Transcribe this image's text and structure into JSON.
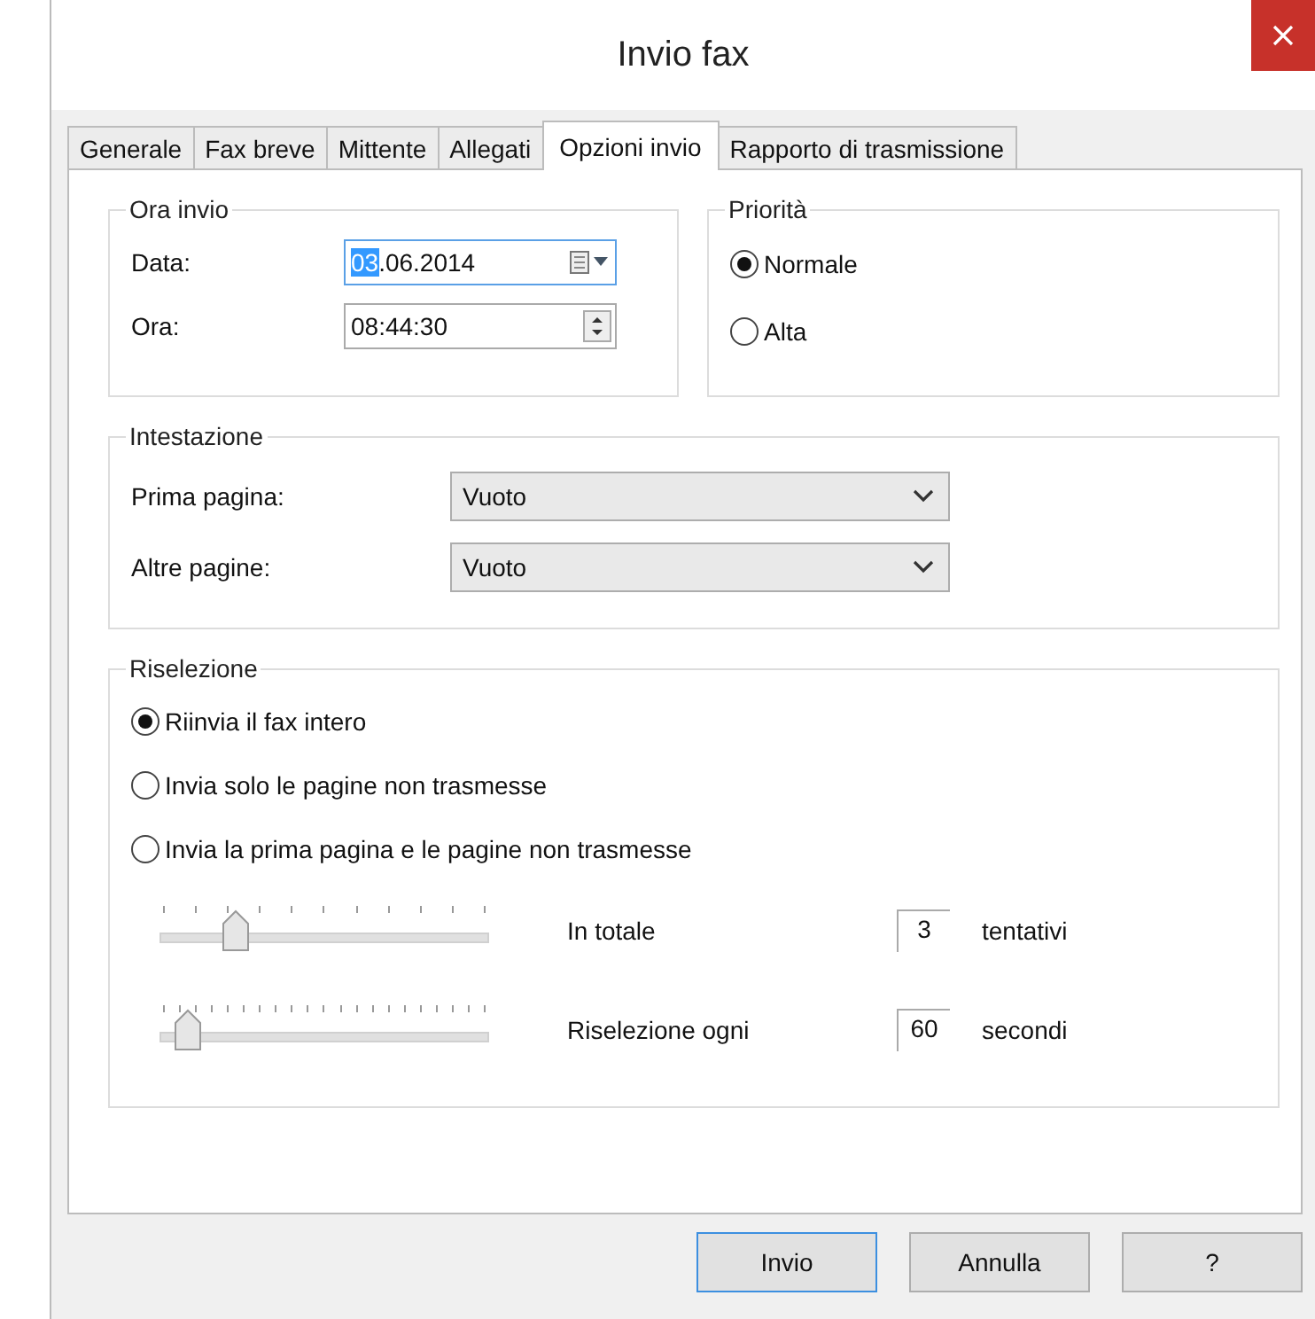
{
  "window": {
    "title": "Invio fax"
  },
  "tabs": [
    {
      "label": "Generale",
      "selected": false
    },
    {
      "label": "Fax breve",
      "selected": false
    },
    {
      "label": "Mittente",
      "selected": false
    },
    {
      "label": "Allegati",
      "selected": false
    },
    {
      "label": "Opzioni invio",
      "selected": true
    },
    {
      "label": "Rapporto di trasmissione",
      "selected": false
    }
  ],
  "ora_invio": {
    "title": "Ora invio",
    "date_label": "Data:",
    "date_selected": "03",
    "date_rest": ".06.2014",
    "time_label": "Ora:",
    "time_value": "08:44:30"
  },
  "priorita": {
    "title": "Priorità",
    "options": [
      {
        "label": "Normale",
        "selected": true
      },
      {
        "label": "Alta",
        "selected": false
      }
    ]
  },
  "intestazione": {
    "title": "Intestazione",
    "rows": [
      {
        "label": "Prima pagina:",
        "value": "Vuoto"
      },
      {
        "label": "Altre pagine:",
        "value": "Vuoto"
      }
    ]
  },
  "riselezione": {
    "title": "Riselezione",
    "options": [
      {
        "label": "Riinvia il fax intero",
        "selected": true
      },
      {
        "label": "Invia solo le pagine non trasmesse",
        "selected": false
      },
      {
        "label": "Invia la prima pagina e le pagine non trasmesse",
        "selected": false
      }
    ],
    "sliders": [
      {
        "level": 0.23,
        "label": "In totale",
        "value": "3",
        "unit": "tentativi"
      },
      {
        "level": 0.08,
        "label": "Riselezione ogni",
        "value": "60",
        "unit": "secondi"
      }
    ]
  },
  "buttons": [
    {
      "label": "Invio",
      "default": true
    },
    {
      "label": "Annulla",
      "default": false
    },
    {
      "label": "?",
      "default": false
    }
  ]
}
